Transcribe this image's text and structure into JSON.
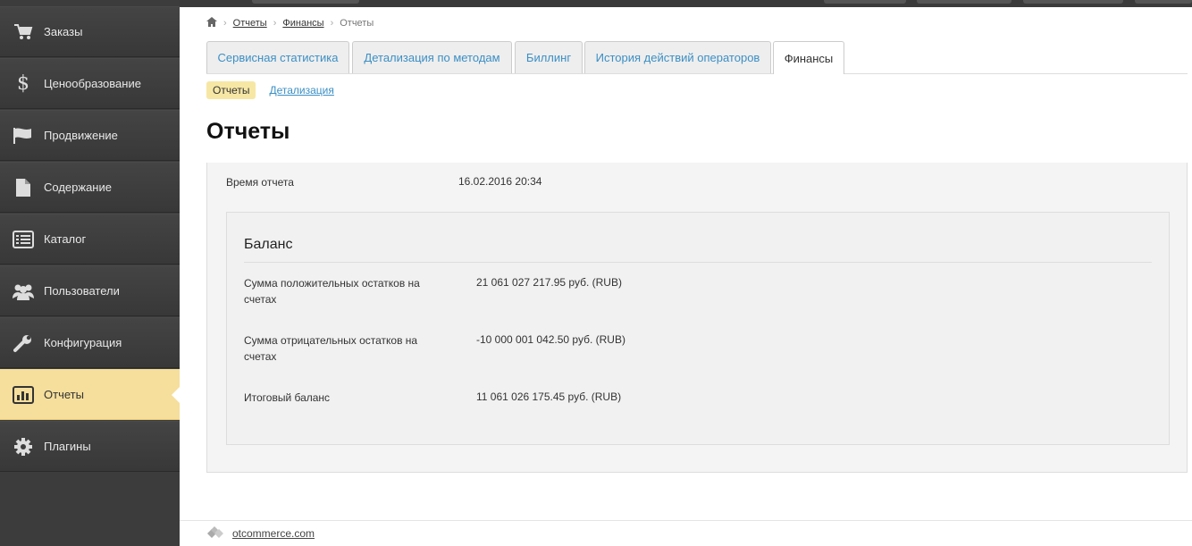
{
  "sidebar": {
    "items": [
      {
        "label": "Заказы",
        "icon": "cart-icon"
      },
      {
        "label": "Ценообразование",
        "icon": "dollar-icon"
      },
      {
        "label": "Продвижение",
        "icon": "flag-icon"
      },
      {
        "label": "Содержание",
        "icon": "document-icon"
      },
      {
        "label": "Каталог",
        "icon": "list-icon"
      },
      {
        "label": "Пользователи",
        "icon": "users-icon"
      },
      {
        "label": "Конфигурация",
        "icon": "wrench-icon"
      },
      {
        "label": "Отчеты",
        "icon": "bar-chart-icon",
        "active": true
      },
      {
        "label": "Плагины",
        "icon": "gear-icon"
      }
    ]
  },
  "breadcrumb": {
    "items": [
      "Отчеты",
      "Финансы",
      "Отчеты"
    ]
  },
  "tabs": [
    {
      "label": "Сервисная статистика"
    },
    {
      "label": "Детализация по методам"
    },
    {
      "label": "Биллинг"
    },
    {
      "label": "История действий операторов"
    },
    {
      "label": "Финансы",
      "active": true
    }
  ],
  "subnav": {
    "active": "Отчеты",
    "link": "Детализация"
  },
  "page_title": "Отчеты",
  "report": {
    "time_label": "Время отчета",
    "time_value": "16.02.2016 20:34",
    "balance": {
      "title": "Баланс",
      "rows": [
        {
          "label_line1": "Сумма положительных остатков на",
          "label_line2": "счетах",
          "value": "21 061 027 217.95 руб. (RUB)"
        },
        {
          "label_line1": "Сумма отрицательных остатков на",
          "label_line2": "счетах",
          "value": "-10 000 001 042.50 руб. (RUB)"
        },
        {
          "label_line1": "Итоговый баланс",
          "label_line2": "",
          "value": "11 061 026 175.45 руб. (RUB)"
        }
      ]
    }
  },
  "footer": {
    "link": "otcommerce.com"
  },
  "colors": {
    "sidebar_bg": "#3c3c3c",
    "active_bg": "#f6df9c",
    "link": "#3b8fc5"
  }
}
